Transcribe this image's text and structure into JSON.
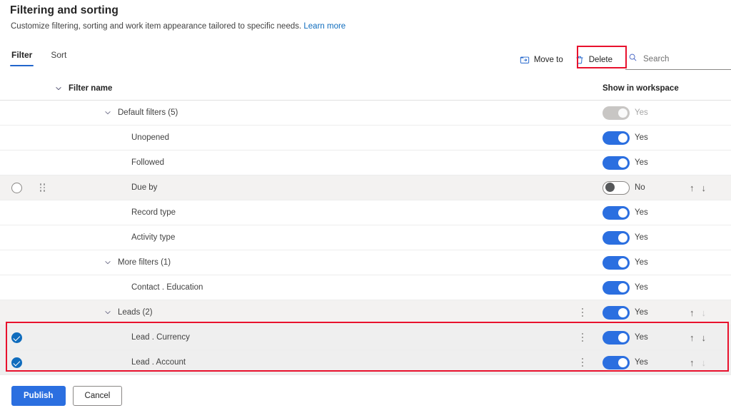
{
  "header": {
    "title": "Filtering and sorting",
    "subtitle": "Customize filtering, sorting and work item appearance tailored to specific needs.",
    "learn_more": "Learn more"
  },
  "tabs": [
    {
      "label": "Filter",
      "active": true
    },
    {
      "label": "Sort",
      "active": false
    }
  ],
  "toolbar": {
    "move_to_label": "Move to",
    "delete_label": "Delete",
    "search_placeholder": "Search",
    "search_value": ""
  },
  "columns": {
    "filter_name": "Filter name",
    "show_in_workspace": "Show in workspace"
  },
  "rows": [
    {
      "label": "Default filters (5)",
      "indent": 1,
      "chevron": true,
      "toggle": "disabled",
      "toggle_label": "Yes",
      "toggle_label_dim": true,
      "selected": false,
      "hover": false,
      "kebab": false,
      "arrows": "none",
      "shaded": false
    },
    {
      "label": "Unopened",
      "indent": 2,
      "chevron": false,
      "toggle": "on",
      "toggle_label": "Yes",
      "toggle_label_dim": false,
      "selected": false,
      "hover": false,
      "kebab": false,
      "arrows": "none",
      "shaded": false
    },
    {
      "label": "Followed",
      "indent": 2,
      "chevron": false,
      "toggle": "on",
      "toggle_label": "Yes",
      "toggle_label_dim": false,
      "selected": false,
      "hover": false,
      "kebab": false,
      "arrows": "none",
      "shaded": false
    },
    {
      "label": "Due by",
      "indent": 2,
      "chevron": false,
      "toggle": "off",
      "toggle_label": "No",
      "toggle_label_dim": false,
      "selected": false,
      "hover": true,
      "kebab": false,
      "arrows": "both",
      "shaded": true
    },
    {
      "label": "Record type",
      "indent": 2,
      "chevron": false,
      "toggle": "on",
      "toggle_label": "Yes",
      "toggle_label_dim": false,
      "selected": false,
      "hover": false,
      "kebab": false,
      "arrows": "none",
      "shaded": false
    },
    {
      "label": "Activity type",
      "indent": 2,
      "chevron": false,
      "toggle": "on",
      "toggle_label": "Yes",
      "toggle_label_dim": false,
      "selected": false,
      "hover": false,
      "kebab": false,
      "arrows": "none",
      "shaded": false
    },
    {
      "label": "More filters (1)",
      "indent": 1,
      "chevron": true,
      "toggle": "on",
      "toggle_label": "Yes",
      "toggle_label_dim": false,
      "selected": false,
      "hover": false,
      "kebab": false,
      "arrows": "none",
      "shaded": false
    },
    {
      "label": "Contact . Education",
      "indent": 2,
      "chevron": false,
      "toggle": "on",
      "toggle_label": "Yes",
      "toggle_label_dim": false,
      "selected": false,
      "hover": false,
      "kebab": false,
      "arrows": "none",
      "shaded": false
    },
    {
      "label": "Leads (2)",
      "indent": 1,
      "chevron": true,
      "toggle": "on",
      "toggle_label": "Yes",
      "toggle_label_dim": false,
      "selected": false,
      "hover": false,
      "kebab": true,
      "arrows": "up",
      "shaded": true
    },
    {
      "label": "Lead . Currency",
      "indent": 2,
      "chevron": false,
      "toggle": "on",
      "toggle_label": "Yes",
      "toggle_label_dim": false,
      "selected": true,
      "hover": false,
      "kebab": true,
      "arrows": "both",
      "shaded": true
    },
    {
      "label": "Lead . Account",
      "indent": 2,
      "chevron": false,
      "toggle": "on",
      "toggle_label": "Yes",
      "toggle_label_dim": false,
      "selected": true,
      "hover": false,
      "kebab": true,
      "arrows": "dim",
      "shaded": true
    }
  ],
  "footer": {
    "publish_label": "Publish",
    "cancel_label": "Cancel"
  },
  "colors": {
    "accent": "#2b6fe0",
    "link": "#0f6cbd",
    "annotation": "#e8112d",
    "toggle_on": "#2b6fe0",
    "toggle_disabled": "#c8c6c4"
  }
}
